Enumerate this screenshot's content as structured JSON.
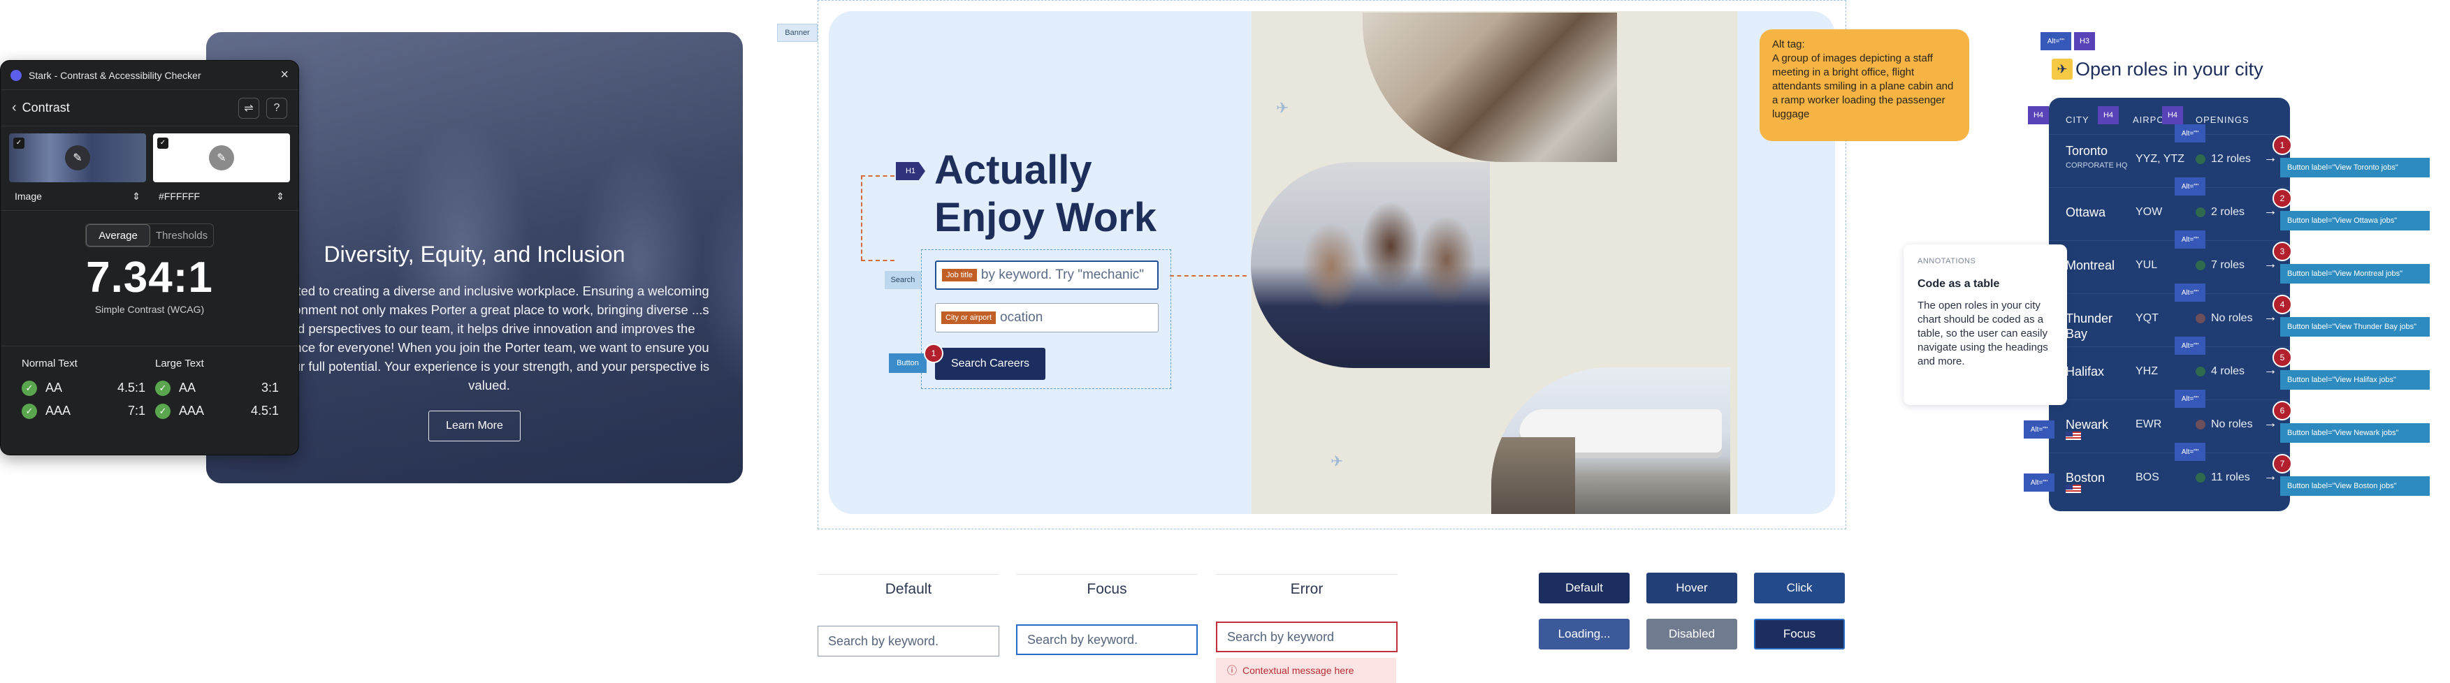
{
  "stark": {
    "app_title": "Stark - Contrast & Accessibility Checker",
    "section": "Contrast",
    "fg_select": "Image",
    "bg_select": "#FFFFFF",
    "tabs": [
      "Average",
      "Thresholds"
    ],
    "ratio": "7.34:1",
    "ratio_caption": "Simple Contrast (WCAG)",
    "normal_text": {
      "label": "Normal Text",
      "rows": [
        {
          "level": "AA",
          "value": "4.5:1"
        },
        {
          "level": "AAA",
          "value": "7:1"
        }
      ]
    },
    "large_text": {
      "label": "Large Text",
      "rows": [
        {
          "level": "AA",
          "value": "3:1"
        },
        {
          "level": "AAA",
          "value": "4.5:1"
        }
      ]
    }
  },
  "diversity": {
    "title": "Diversity, Equity, and Inclusion",
    "body": "...mitted to creating a diverse and inclusive workplace. Ensuring a welcoming ...vironment not only makes Porter a great place to work, bringing diverse ...s and perspectives to our team, it helps drive innovation and improves the ...rience for everyone! When you join the Porter team, we want to ensure you ...your full potential. Your experience is your strength, and your perspective is valued.",
    "cta": "Learn More"
  },
  "hero": {
    "banner_tag": "Banner",
    "h1_tag": "H1",
    "heading": "Actually Enjoy Work",
    "search_tag": "Search",
    "keyword_tag": "Job title",
    "keyword_placeholder": "by keyword. Try \"mechanic\"",
    "location_tag": "City or airport",
    "location_placeholder": "ocation",
    "button_tag": "Button",
    "search_button": "Search Careers",
    "search_badge": "1",
    "alt_note_title": "Alt tag:",
    "alt_note_body": "A group of images depicting a staff meeting in a bright office, flight attendants smiling in a plane cabin and a ramp worker loading the passenger luggage"
  },
  "field_states": {
    "labels": [
      "Default",
      "Focus",
      "Error"
    ],
    "placeholders": [
      "Search by keyword.",
      "Search by keyword.",
      "Search by keyword"
    ],
    "error_message": "Contextual message here"
  },
  "button_states": [
    {
      "label": "Default",
      "color": "#1b2e5f"
    },
    {
      "label": "Hover",
      "color": "#223f78"
    },
    {
      "label": "Click",
      "color": "#234a8a"
    },
    {
      "label": "Loading...",
      "color": "#3c5a9a"
    },
    {
      "label": "Disabled",
      "color": "#707b90"
    },
    {
      "label": "Focus",
      "color": "#1b2e5f"
    }
  ],
  "roles": {
    "title": "Open roles in your city",
    "alt_tag": "Alt=\"\"",
    "h3_tag": "H3",
    "h4_tag": "H4",
    "headers": [
      "CITY",
      "AIRPO",
      "OPENINGS"
    ],
    "rows": [
      {
        "city": "Toronto",
        "sub": "CORPORATE HQ",
        "code": "YYZ, YTZ",
        "openings": "12 roles",
        "has": true,
        "badge": "1",
        "btn": "Button label=\"View Toronto jobs\""
      },
      {
        "city": "Ottawa",
        "sub": "",
        "code": "YOW",
        "openings": "2 roles",
        "has": true,
        "badge": "2",
        "btn": "Button label=\"View Ottawa jobs\""
      },
      {
        "city": "Montreal",
        "sub": "",
        "code": "YUL",
        "openings": "7 roles",
        "has": true,
        "badge": "3",
        "btn": "Button label=\"View Montreal jobs\""
      },
      {
        "city": "Thunder Bay",
        "sub": "",
        "code": "YQT",
        "openings": "No roles",
        "has": false,
        "badge": "4",
        "btn": "Button label=\"View Thunder Bay jobs\""
      },
      {
        "city": "Halifax",
        "sub": "",
        "code": "YHZ",
        "openings": "4 roles",
        "has": true,
        "badge": "5",
        "btn": "Button label=\"View Halifax jobs\""
      },
      {
        "city": "Newark",
        "sub": "",
        "code": "EWR",
        "openings": "No roles",
        "has": false,
        "badge": "6",
        "btn": "Button label=\"View Newark jobs\""
      },
      {
        "city": "Boston",
        "sub": "",
        "code": "BOS",
        "openings": "11 roles",
        "has": true,
        "badge": "7",
        "btn": "Button label=\"View Boston jobs\""
      }
    ],
    "annotation": {
      "kicker": "ANNOTATIONS",
      "title": "Code as a table",
      "body": "The open roles in your city chart should be coded as a table, so the user can easily navigate using the headings and more."
    }
  }
}
